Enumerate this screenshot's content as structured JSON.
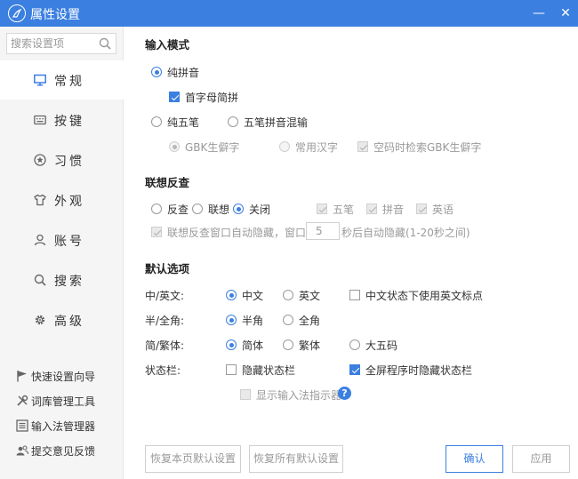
{
  "window": {
    "title": "属性设置",
    "minimize": "—",
    "close": "✕"
  },
  "sidebar": {
    "search_placeholder": "搜索设置项",
    "nav": [
      {
        "label": "常规",
        "icon": "monitor-icon"
      },
      {
        "label": "按键",
        "icon": "keyboard-icon"
      },
      {
        "label": "习惯",
        "icon": "star-circle-icon"
      },
      {
        "label": "外观",
        "icon": "shirt-icon"
      },
      {
        "label": "账号",
        "icon": "user-icon"
      },
      {
        "label": "搜索",
        "icon": "search-icon"
      },
      {
        "label": "高级",
        "icon": "gear-icon"
      }
    ],
    "active_index": 0,
    "tools": [
      {
        "label": "快速设置向导",
        "icon": "flag-icon"
      },
      {
        "label": "词库管理工具",
        "icon": "tools-icon"
      },
      {
        "label": "输入法管理器",
        "icon": "list-icon"
      },
      {
        "label": "提交意见反馈",
        "icon": "users-icon"
      }
    ]
  },
  "input_mode": {
    "title": "输入模式",
    "pinyin": "纯拼音",
    "initials": "首字母简拼",
    "wubi": "纯五笔",
    "mixed": "五笔拼音混输",
    "gbk": "GBK生僻字",
    "common": "常用汉字",
    "empty_gbk": "空码时检索GBK生僻字"
  },
  "assoc": {
    "title": "联想反查",
    "reverse": "反查",
    "assoc": "联想",
    "off": "关闭",
    "wubi": "五笔",
    "pinyin": "拼音",
    "english": "英语",
    "autohide_pre": "联想反查窗口自动隐藏，窗口在",
    "autohide_value": "5",
    "autohide_post": "秒后自动隐藏(1-20秒之间)"
  },
  "defaults": {
    "title": "默认选项",
    "cn_en_label": "中/英文:",
    "cn": "中文",
    "en": "英文",
    "cn_punct": "中文状态下使用英文标点",
    "width_label": "半/全角:",
    "half": "半角",
    "full": "全角",
    "script_label": "简/繁体:",
    "simplified": "简体",
    "traditional": "繁体",
    "big5": "大五码",
    "status_label": "状态栏:",
    "hide_status": "隐藏状态栏",
    "fullscreen_hide": "全屏程序时隐藏状态栏",
    "show_indicator": "显示输入法指示器",
    "help": "?"
  },
  "footer": {
    "restore_page": "恢复本页默认设置",
    "restore_all": "恢复所有默认设置",
    "ok": "确认",
    "apply": "应用"
  }
}
